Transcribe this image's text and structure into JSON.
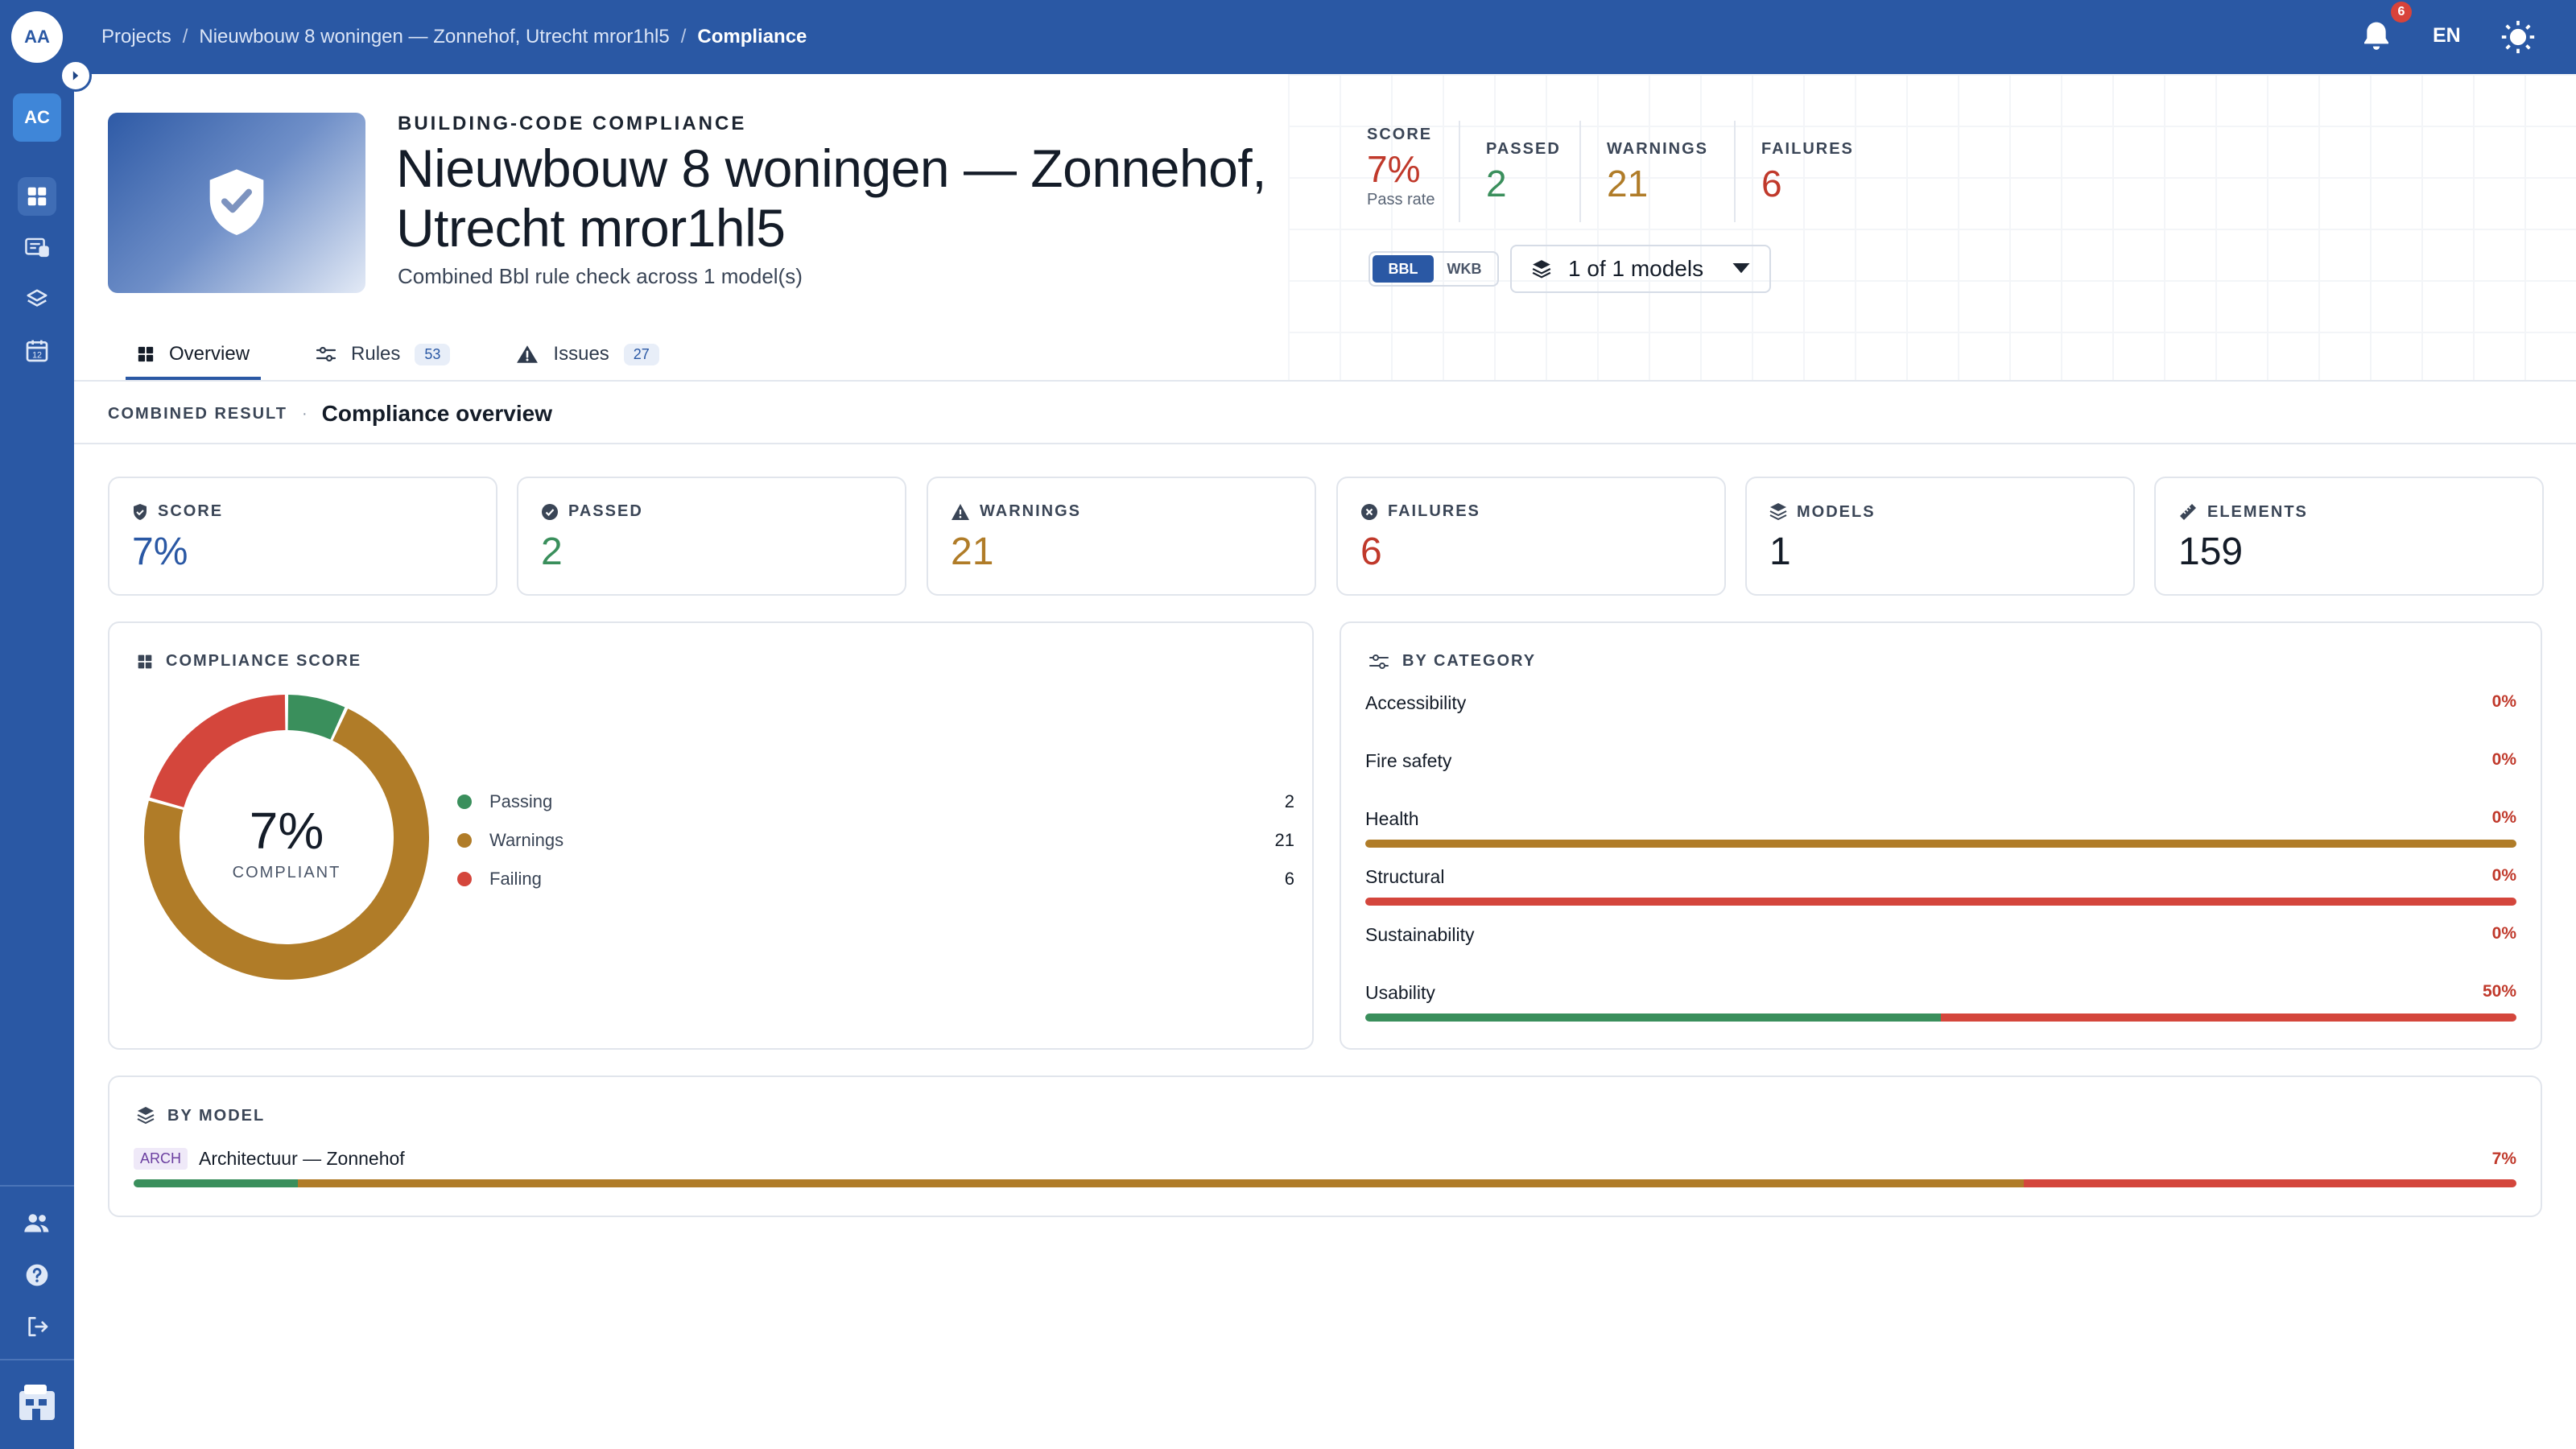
{
  "colors": {
    "primary": "#2a58a4",
    "pass": "#3a8f5c",
    "warn": "#b07c28",
    "fail": "#d4463c",
    "score": "#c0392b"
  },
  "topbar": {
    "breadcrumb": [
      "Projects",
      "Nieuwbouw 8 woningen — Zonnehof, Utrecht mror1hl5",
      "Compliance"
    ],
    "separator": "/",
    "notification_count": "6",
    "language": "EN"
  },
  "sidebar": {
    "avatar": "AA",
    "workspace": "AC",
    "items": [
      "grid-icon",
      "news-icon",
      "layers-icon",
      "calendar-icon"
    ],
    "calendar_day": "12",
    "bottom_items": [
      "people-icon",
      "help-icon",
      "logout-icon"
    ]
  },
  "header": {
    "eyebrow": "BUILDING-CODE COMPLIANCE",
    "title_line1": "Nieuwbouw 8 woningen — Zonnehof,",
    "title_line2": "Utrecht mror1hl5",
    "subtitle": "Combined Bbl rule check across 1 model(s)",
    "stats": {
      "score_label": "SCORE",
      "score_value": "7%",
      "score_sub": "Pass rate",
      "passed_label": "PASSED",
      "passed_value": "2",
      "warnings_label": "WARNINGS",
      "warnings_value": "21",
      "failures_label": "FAILURES",
      "failures_value": "6"
    },
    "toggle": [
      "BBL",
      "WKB"
    ],
    "models_dropdown": "1 of 1 models"
  },
  "tabs": [
    {
      "label": "Overview",
      "count": ""
    },
    {
      "label": "Rules",
      "count": "53"
    },
    {
      "label": "Issues",
      "count": "27"
    }
  ],
  "section": {
    "kicker": "COMBINED RESULT",
    "dot": "·",
    "title": "Compliance overview"
  },
  "kpis": [
    {
      "label": "SCORE",
      "value": "7%",
      "icon": "shield-icon"
    },
    {
      "label": "PASSED",
      "value": "2",
      "icon": "check-circle-icon"
    },
    {
      "label": "WARNINGS",
      "value": "21",
      "icon": "warning-icon"
    },
    {
      "label": "FAILURES",
      "value": "6",
      "icon": "x-circle-icon"
    },
    {
      "label": "MODELS",
      "value": "1",
      "icon": "layers-icon"
    },
    {
      "label": "ELEMENTS",
      "value": "159",
      "icon": "ruler-icon"
    }
  ],
  "compliance_score": {
    "heading": "COMPLIANCE SCORE",
    "center_value": "7%",
    "center_label": "COMPLIANT",
    "legend": [
      {
        "label": "Passing",
        "value": "2"
      },
      {
        "label": "Warnings",
        "value": "21"
      },
      {
        "label": "Failing",
        "value": "6"
      }
    ]
  },
  "by_category": {
    "heading": "BY CATEGORY",
    "items": [
      {
        "name": "Accessibility",
        "pct": "0%",
        "pass": 0,
        "warn": 0,
        "fail": 0
      },
      {
        "name": "Fire safety",
        "pct": "0%",
        "pass": 0,
        "warn": 0,
        "fail": 0
      },
      {
        "name": "Health",
        "pct": "0%",
        "pass": 0,
        "warn": 1,
        "fail": 0
      },
      {
        "name": "Structural",
        "pct": "0%",
        "pass": 0,
        "warn": 0,
        "fail": 1
      },
      {
        "name": "Sustainability",
        "pct": "0%",
        "pass": 0,
        "warn": 0,
        "fail": 0
      },
      {
        "name": "Usability",
        "pct": "50%",
        "pass": 0.5,
        "warn": 0,
        "fail": 0.5
      }
    ]
  },
  "by_model": {
    "heading": "BY MODEL",
    "items": [
      {
        "tag": "ARCH",
        "name": "Architectuur — Zonnehof",
        "pct": "7%",
        "pass": 2,
        "warn": 21,
        "fail": 6
      }
    ]
  }
}
